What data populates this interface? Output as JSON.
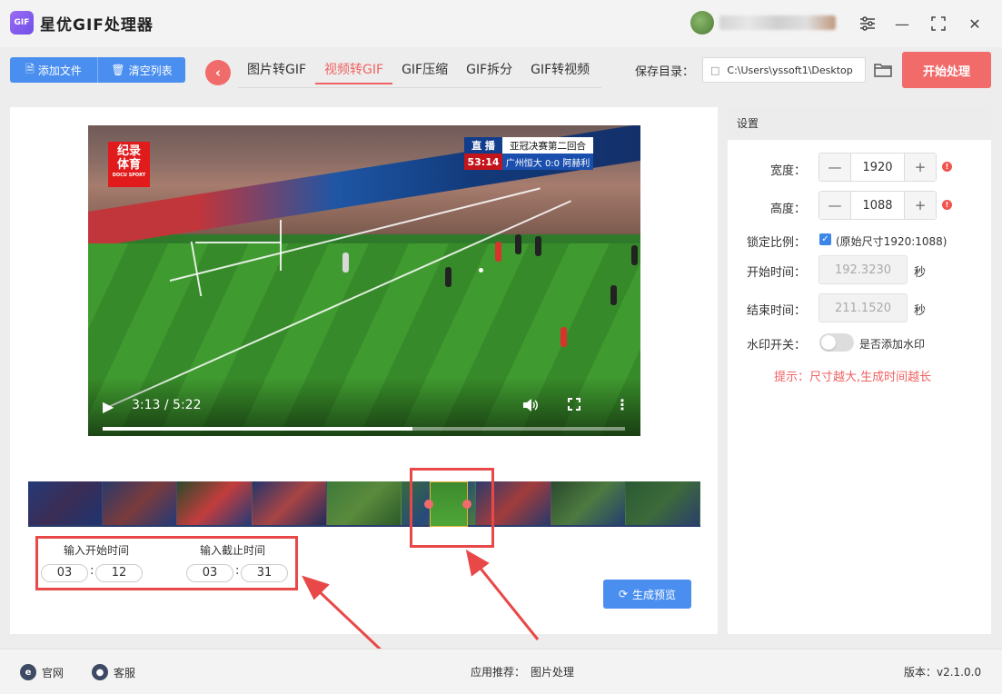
{
  "app": {
    "title": "星优GIF处理器",
    "logo_text": "GIF"
  },
  "window": {
    "settings_icon": "☰",
    "minimize": "—",
    "maximize": "⛶",
    "close": "✕"
  },
  "toolbar": {
    "add_file": "添加文件",
    "clear_list": "清空列表",
    "tabs": [
      "图片转GIF",
      "视频转GIF",
      "GIF压缩",
      "GIF拆分",
      "GIF转视频"
    ],
    "active_tab_index": 1,
    "save_dir_label": "保存目录：",
    "save_dir_value": "C:\\Users\\yssoft1\\Desktop",
    "start_button": "开始处理"
  },
  "video": {
    "badge_line1": "纪录",
    "badge_line2": "体育",
    "badge_sub": "DOCU SPORT",
    "live_label": "直 播",
    "match_title": "亚冠决赛第二回合",
    "game_clock": "53:14",
    "score_line": "广州恒大 0:0 阿赫利",
    "time_display": "3:13 / 5:22",
    "progress_fraction": 0.593
  },
  "trim": {
    "start_label": "输入开始时间",
    "end_label": "输入截止时间",
    "start_min": "03",
    "start_sec": "12",
    "end_min": "03",
    "end_sec": "31",
    "colon": ":",
    "preview_button": "生成预览"
  },
  "settings": {
    "header": "设置",
    "width_label": "宽度：",
    "width_value": "1920",
    "height_label": "高度：",
    "height_value": "1088",
    "lock_label": "锁定比例：",
    "lock_note": "(原始尺寸1920:1088)",
    "start_time_label": "开始时间：",
    "start_time_value": "192.3230",
    "end_time_label": "结束时间：",
    "end_time_value": "211.1520",
    "seconds_unit": "秒",
    "watermark_label": "水印开关：",
    "watermark_note": "是否添加水印",
    "hint": "提示：尺寸越大,生成时间越长",
    "minus": "—",
    "plus": "+"
  },
  "footer": {
    "website": "官网",
    "support": "客服",
    "recommend": "应用推荐：",
    "recommend_app": "图片处理",
    "version": "版本：v2.1.0.0"
  },
  "colors": {
    "accent_red": "#f06262",
    "primary_blue": "#4a8ff0"
  }
}
